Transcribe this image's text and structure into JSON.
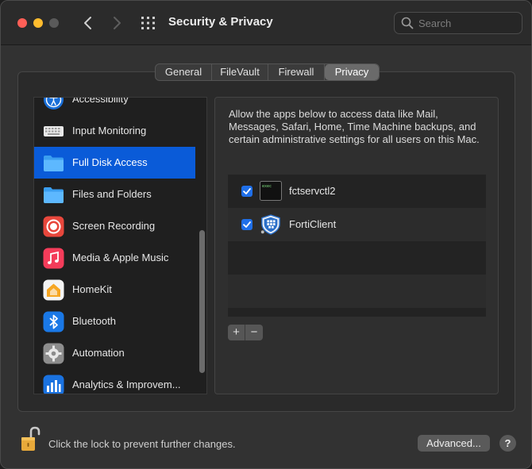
{
  "window": {
    "title": "Security & Privacy"
  },
  "search": {
    "placeholder": "Search"
  },
  "tabs": [
    {
      "label": "General"
    },
    {
      "label": "FileVault"
    },
    {
      "label": "Firewall"
    },
    {
      "label": "Privacy",
      "active": true
    }
  ],
  "sidebar": {
    "items": [
      {
        "label": "Accessibility",
        "icon": "accessibility-icon"
      },
      {
        "label": "Input Monitoring",
        "icon": "keyboard-icon"
      },
      {
        "label": "Full Disk Access",
        "icon": "folder-icon",
        "selected": true
      },
      {
        "label": "Files and Folders",
        "icon": "folder-icon"
      },
      {
        "label": "Screen Recording",
        "icon": "record-icon"
      },
      {
        "label": "Media & Apple Music",
        "icon": "music-note-icon"
      },
      {
        "label": "HomeKit",
        "icon": "home-icon"
      },
      {
        "label": "Bluetooth",
        "icon": "bluetooth-icon"
      },
      {
        "label": "Automation",
        "icon": "gear-icon"
      },
      {
        "label": "Analytics & Improvem...",
        "icon": "bar-chart-icon"
      }
    ]
  },
  "panel": {
    "description": "Allow the apps below to access data like Mail, Messages, Safari, Home, Time Machine backups, and certain administrative settings for all users on this Mac.",
    "apps": [
      {
        "name": "fctservctl2",
        "checked": true,
        "icon": "terminal-icon",
        "terminal_text": "exec"
      },
      {
        "name": "FortiClient",
        "checked": true,
        "icon": "forticlient-shield-icon"
      }
    ],
    "add_label": "+",
    "remove_label": "−"
  },
  "footer": {
    "lock_text": "Click the lock to prevent further changes.",
    "advanced_label": "Advanced...",
    "help_label": "?"
  },
  "colors": {
    "accent": "#0a5bd8",
    "checkbox": "#1f6fe8",
    "close": "#ff5f57",
    "minimize": "#febc2e"
  }
}
